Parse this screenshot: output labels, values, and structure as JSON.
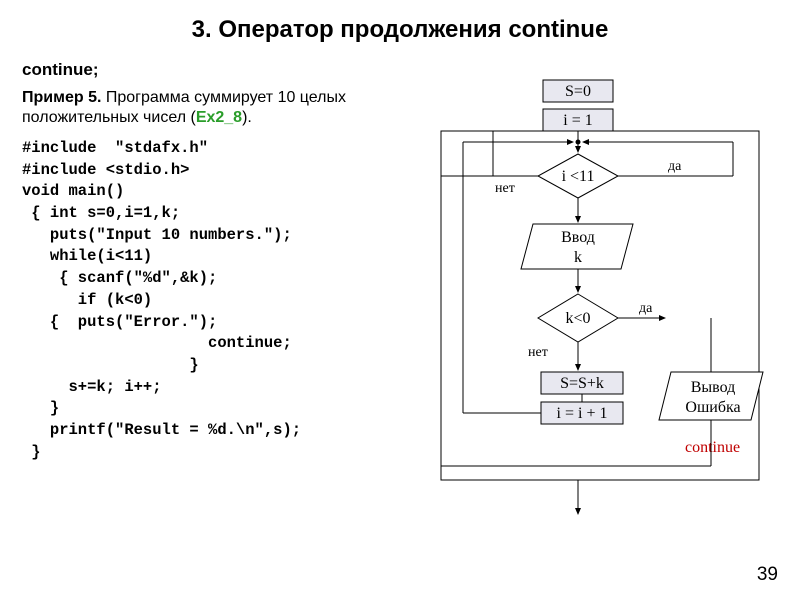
{
  "title": "3. Оператор продолжения continue",
  "subtitle": "continue;",
  "example_label": "Пример 5.",
  "example_text": " Программа суммирует 10 целых положительных чисел (",
  "example_ref": "Ex2_8",
  "example_close": ").",
  "code": "#include  \"stdafx.h\"\n#include <stdio.h>\nvoid main()\n { int s=0,i=1,k;\n   puts(\"Input 10 numbers.\");\n   while(i<11)\n    { scanf(\"%d\",&k);\n      if (k<0)\n   {  puts(\"Error.\");\n                    continue;\n                  }\n     s+=k; i++;\n   }\n   printf(\"Result = %d.\\n\",s);\n }",
  "flowchart": {
    "init_s": "S=0",
    "init_i": "i = 1",
    "cond1": "i <11",
    "input": "Ввод",
    "input_k": "k",
    "cond2": "k<0",
    "assign": "S=S+k",
    "inc": "i = i + 1",
    "error": "Вывод",
    "error2": "Ошибка",
    "yes": "да",
    "no": "нет",
    "continue_label": "continue"
  },
  "pagenum": "39"
}
